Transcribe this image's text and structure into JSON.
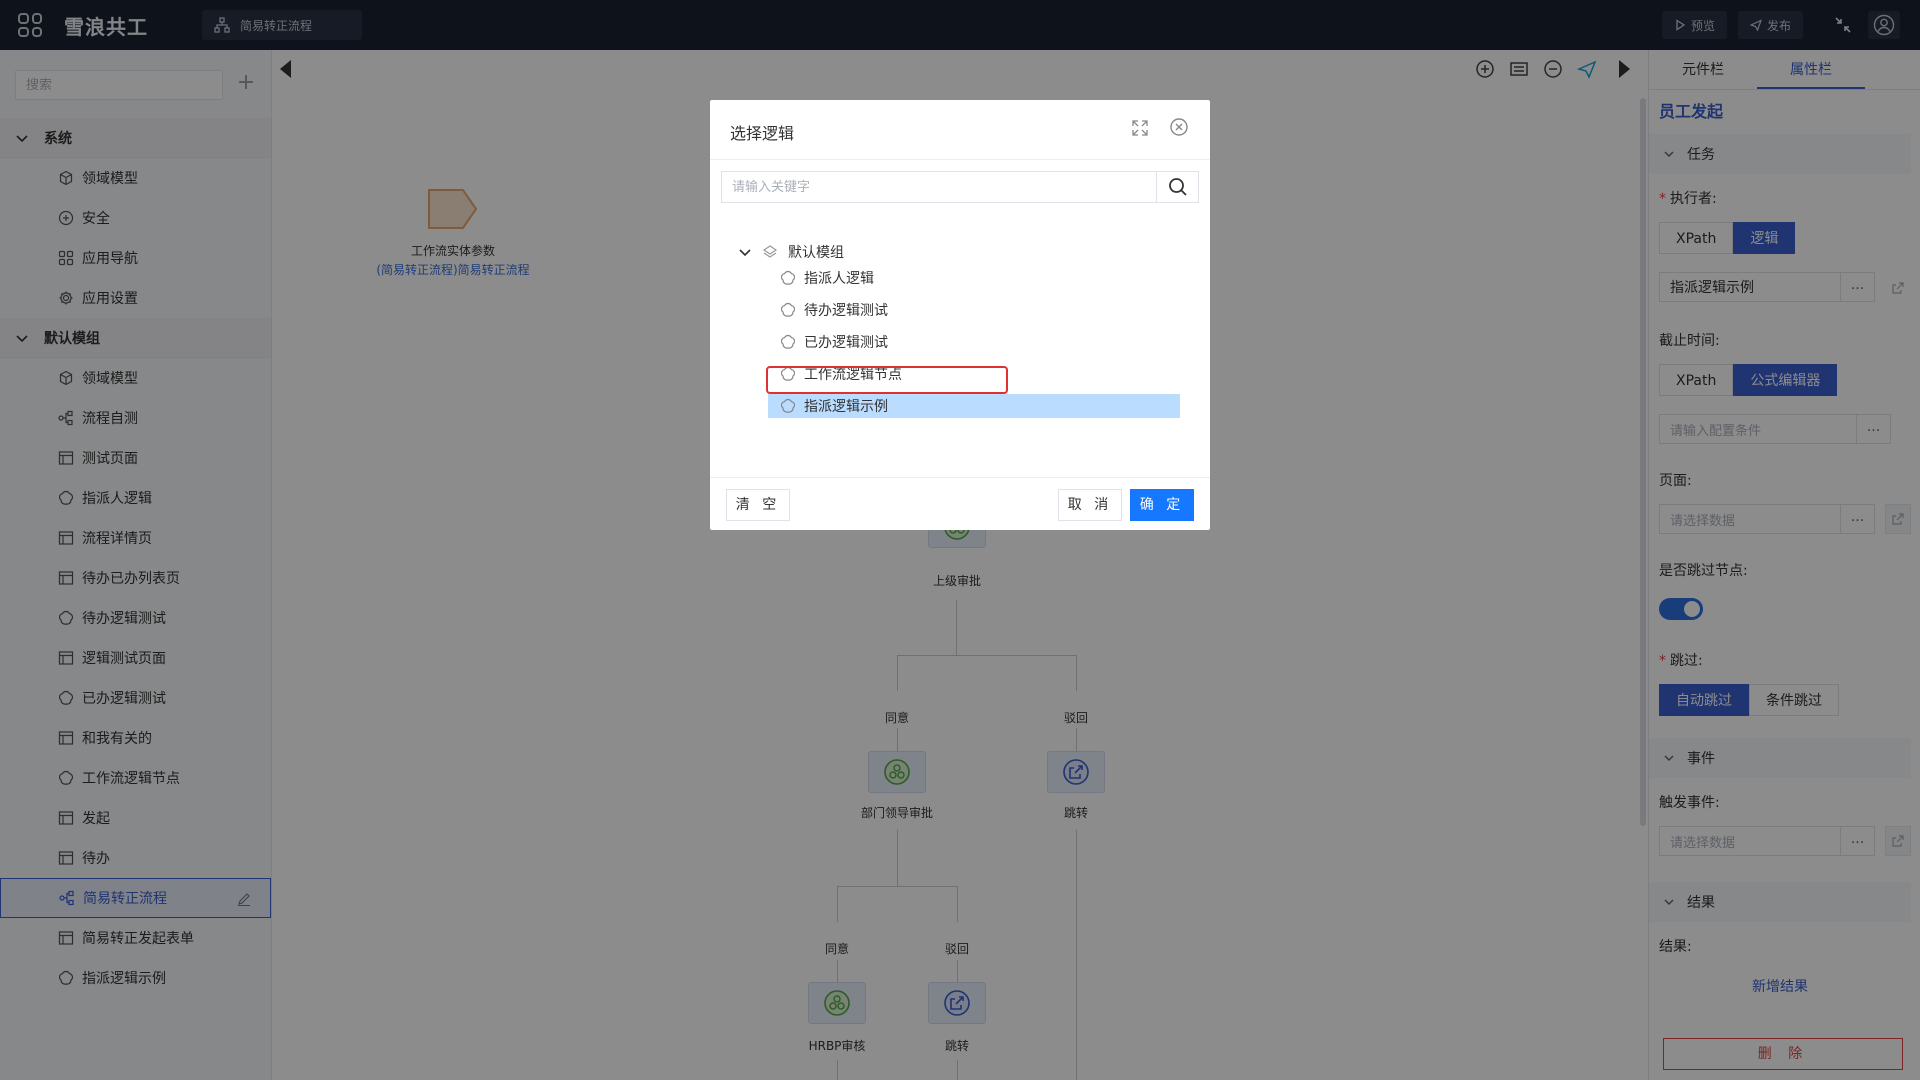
{
  "topbar": {
    "brand": "雪浪共工",
    "tab_label": "简易转正流程",
    "preview": "预览",
    "publish": "发布"
  },
  "sidebar": {
    "search_placeholder": "搜索",
    "groups": [
      {
        "label": "系统",
        "items": [
          {
            "label": "领域模型",
            "icon": "cube-icon"
          },
          {
            "label": "安全",
            "icon": "shield-plus-icon"
          },
          {
            "label": "应用导航",
            "icon": "grid-icon"
          },
          {
            "label": "应用设置",
            "icon": "gear-icon"
          }
        ]
      },
      {
        "label": "默认模组",
        "items": [
          {
            "label": "领域模型",
            "icon": "cube-icon"
          },
          {
            "label": "流程自测",
            "icon": "flow-icon"
          },
          {
            "label": "测试页面",
            "icon": "page-icon"
          },
          {
            "label": "指派人逻辑",
            "icon": "logic-icon"
          },
          {
            "label": "流程详情页",
            "icon": "page-icon"
          },
          {
            "label": "待办已办列表页",
            "icon": "page-icon"
          },
          {
            "label": "待办逻辑测试",
            "icon": "logic-icon"
          },
          {
            "label": "逻辑测试页面",
            "icon": "page-icon"
          },
          {
            "label": "已办逻辑测试",
            "icon": "logic-icon"
          },
          {
            "label": "和我有关的",
            "icon": "page-icon"
          },
          {
            "label": "工作流逻辑节点",
            "icon": "logic-icon"
          },
          {
            "label": "发起",
            "icon": "page-icon"
          },
          {
            "label": "待办",
            "icon": "page-icon"
          },
          {
            "label": "简易转正流程",
            "icon": "flow-icon",
            "active": true
          },
          {
            "label": "简易转正发起表单",
            "icon": "page-icon"
          },
          {
            "label": "指派逻辑示例",
            "icon": "logic-icon"
          }
        ]
      }
    ]
  },
  "canvas": {
    "entity_title": "工作流实体参数",
    "entity_subtitle": "(简易转正流程)简易转正流程",
    "nodes": {
      "superior": "上级审批",
      "agree1": "同意",
      "reject1": "驳回",
      "dept_leader": "部门领导审批",
      "jump1": "跳转",
      "agree2": "同意",
      "reject2": "驳回",
      "hrbp": "HRBP审核",
      "jump2": "跳转"
    }
  },
  "rpanel": {
    "tab_components": "元件栏",
    "tab_properties": "属性栏",
    "title": "员工发起",
    "sect_task": "任务",
    "executor_label": "执行者:",
    "executor_opts": [
      "XPath",
      "逻辑"
    ],
    "executor_value": "指派逻辑示例",
    "deadline_label": "截止时间:",
    "deadline_opts": [
      "XPath",
      "公式编辑器"
    ],
    "deadline_placeholder": "请输入配置条件",
    "page_label": "页面:",
    "page_placeholder": "请选择数据",
    "skip_node_label": "是否跳过节点:",
    "skip_label": "跳过:",
    "skip_opts": [
      "自动跳过",
      "条件跳过"
    ],
    "sect_event": "事件",
    "trigger_label": "触发事件:",
    "trigger_placeholder": "请选择数据",
    "sect_result": "结果",
    "result_label": "结果:",
    "add_result": "新增结果",
    "delete": "删 除",
    "dots": "..."
  },
  "modal": {
    "title": "选择逻辑",
    "search_placeholder": "请输入关键字",
    "root": "默认模组",
    "leaves": [
      "指派人逻辑",
      "待办逻辑测试",
      "已办逻辑测试",
      "工作流逻辑节点",
      "指派逻辑示例"
    ],
    "selected_index": 4,
    "btn_clear": "清 空",
    "btn_cancel": "取 消",
    "btn_ok": "确 定"
  },
  "colors": {
    "primary": "#3a5fcd",
    "ok_button": "#1677ff",
    "selected_row": "#b9dcff",
    "highlight_box": "#e03131",
    "topbar": "#1b2231"
  }
}
